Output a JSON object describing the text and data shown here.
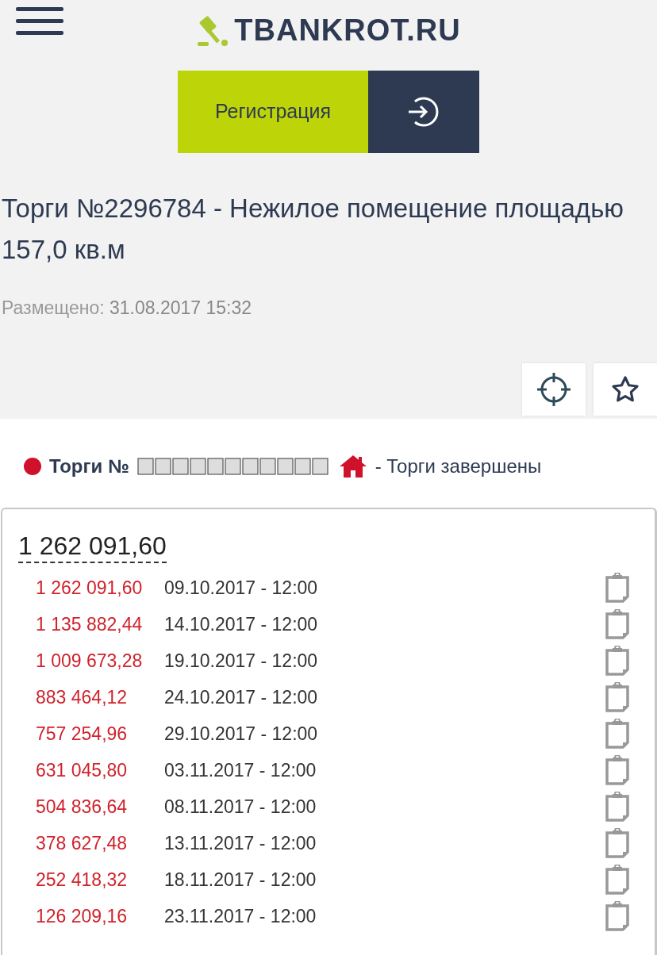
{
  "header": {
    "logo": "TBANKROT.RU",
    "register_button": "Регистрация"
  },
  "title": "Торги №2296784 - Нежилое помещение площадью 157,0 кв.м",
  "posted": {
    "label": "Размещено:",
    "value": "31.08.2017 15:32"
  },
  "status": {
    "color": "#d0112b",
    "label": "Торги №",
    "text": "- Торги завершены"
  },
  "price": "1 262 091,60",
  "schedule": [
    {
      "price": "1 262 091,60",
      "date": "09.10.2017 - 12:00"
    },
    {
      "price": "1 135 882,44",
      "date": "14.10.2017 - 12:00"
    },
    {
      "price": "1 009 673,28",
      "date": "19.10.2017 - 12:00"
    },
    {
      "price": "883 464,12",
      "date": "24.10.2017 - 12:00"
    },
    {
      "price": "757 254,96",
      "date": "29.10.2017 - 12:00"
    },
    {
      "price": "631 045,80",
      "date": "03.11.2017 - 12:00"
    },
    {
      "price": "504 836,64",
      "date": "08.11.2017 - 12:00"
    },
    {
      "price": "378 627,48",
      "date": "13.11.2017 - 12:00"
    },
    {
      "price": "252 418,32",
      "date": "18.11.2017 - 12:00"
    },
    {
      "price": "126 209,16",
      "date": "23.11.2017 - 12:00"
    }
  ]
}
